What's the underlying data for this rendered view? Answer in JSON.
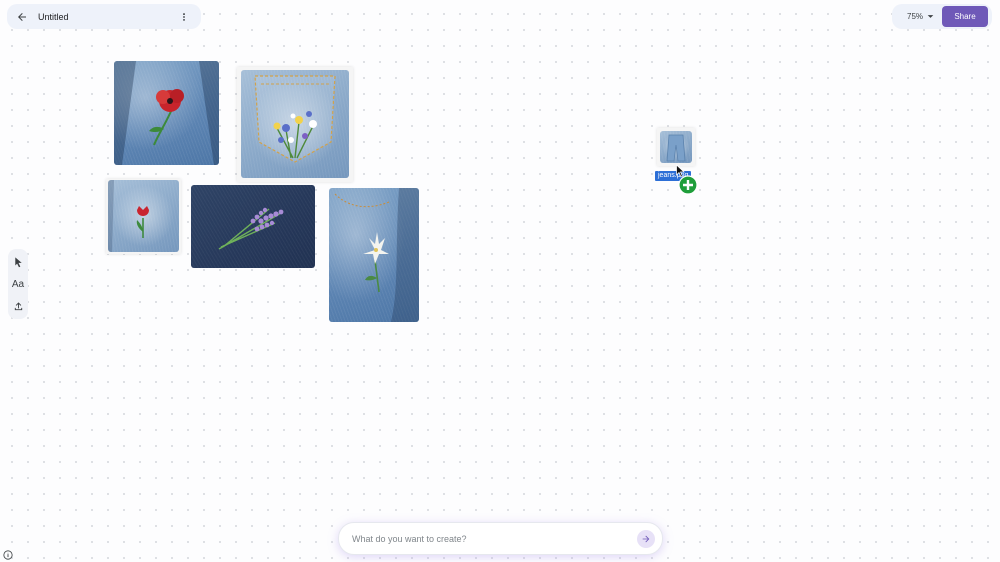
{
  "header": {
    "title": "Untitled",
    "back_icon": "arrow-left-icon",
    "more_icon": "more-vertical-icon"
  },
  "top_right": {
    "zoom_label": "75%",
    "share_label": "Share",
    "share_color": "#6f59b8"
  },
  "toolbar": {
    "tools": [
      "cursor-icon",
      "text-add-icon",
      "upload-icon"
    ],
    "text_tool_label": "Aa"
  },
  "canvas": {
    "images": [
      {
        "name": "jeans-red-poppy-embroidery",
        "subject": "poppy"
      },
      {
        "name": "jeans-pocket-wildflower-embroidery",
        "subject": "wildflowers"
      },
      {
        "name": "jeans-red-tulip-embroidery",
        "subject": "tulip"
      },
      {
        "name": "dark-denim-lavender-embroidery",
        "subject": "lavender"
      },
      {
        "name": "jeans-white-lily-embroidery",
        "subject": "lily"
      }
    ],
    "dragging_item": {
      "label": "jeans.png"
    }
  },
  "prompt": {
    "placeholder": "What do you want to create?",
    "value": "",
    "send_icon": "arrow-right-icon"
  },
  "footer": {
    "info_icon": "info-icon"
  }
}
